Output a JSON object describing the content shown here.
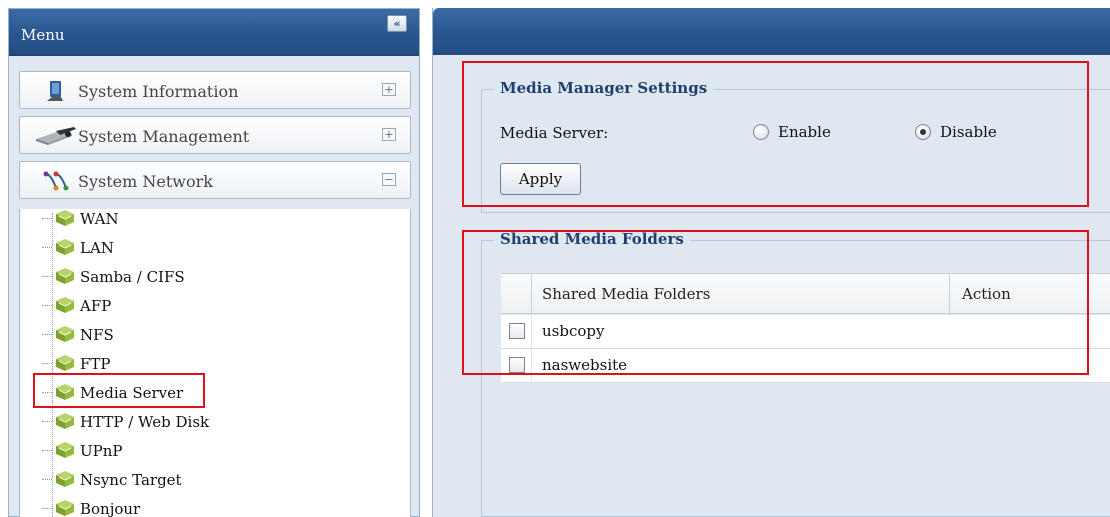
{
  "left_panel": {
    "title": "Menu",
    "collapse_label": "«",
    "sections": [
      {
        "label": "System Information",
        "toggle": "+",
        "icon": "monitor-icon"
      },
      {
        "label": "System Management",
        "toggle": "+",
        "icon": "management-icon"
      },
      {
        "label": "System Network",
        "toggle": "−",
        "icon": "network-icon"
      }
    ],
    "network_items": [
      {
        "label": "WAN",
        "icon": "network-item-icon"
      },
      {
        "label": "LAN",
        "icon": "network-item-icon"
      },
      {
        "label": "Samba / CIFS",
        "icon": "network-item-icon"
      },
      {
        "label": "AFP",
        "icon": "network-item-icon"
      },
      {
        "label": "NFS",
        "icon": "network-item-icon"
      },
      {
        "label": "FTP",
        "icon": "network-item-icon"
      },
      {
        "label": "Media Server",
        "icon": "network-item-icon",
        "selected": true
      },
      {
        "label": "HTTP / Web Disk",
        "icon": "network-item-icon"
      },
      {
        "label": "UPnP",
        "icon": "network-item-icon"
      },
      {
        "label": "Nsync Target",
        "icon": "network-item-icon"
      },
      {
        "label": "Bonjour",
        "icon": "network-item-icon"
      }
    ]
  },
  "media_settings": {
    "legend": "Media Manager Settings",
    "field_label": "Media Server:",
    "enable_label": "Enable",
    "disable_label": "Disable",
    "selected": "Disable",
    "apply_label": "Apply"
  },
  "shared_folders": {
    "legend": "Shared Media Folders",
    "columns": [
      "Shared Media Folders",
      "Action"
    ],
    "rows": [
      {
        "name": "usbcopy",
        "checked": false
      },
      {
        "name": "naswebsite",
        "checked": false
      }
    ]
  },
  "colors": {
    "header_blue": "#2a5690",
    "highlight_red": "#e0101a",
    "panel_bg": "#dfe8f1"
  }
}
